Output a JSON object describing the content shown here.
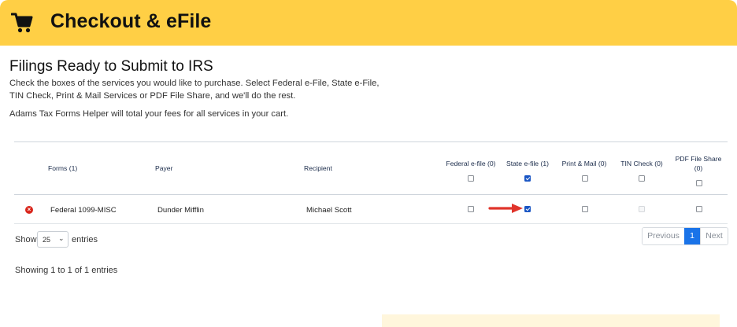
{
  "header": {
    "title": "Checkout & eFile",
    "icon": "shopping-cart-icon"
  },
  "page": {
    "title": "Filings Ready to Submit to IRS",
    "intro": "Check the boxes of the services you would like to purchase. Select Federal e-File, State e-File, TIN Check, Print & Mail Services or PDF File Share, and we'll do the rest.",
    "fees_note": "Adams Tax Forms Helper will total your fees for all services in your cart."
  },
  "table": {
    "columns": {
      "forms": "Forms (1)",
      "payer": "Payer",
      "recipient": "Recipient",
      "federal": "Federal e-file (0)",
      "state": "State e-file (1)",
      "print_mail": "Print & Mail (0)",
      "tin_check": "TIN Check (0)",
      "pdf_share_line1": "PDF File Share",
      "pdf_share_line2": "(0)"
    },
    "select_all": {
      "federal": false,
      "state": true,
      "print_mail": false,
      "tin_check": false,
      "pdf_share": false
    },
    "rows": [
      {
        "form": "Federal 1099-MISC",
        "payer": "Dunder Mifflin",
        "recipient": "Michael Scott",
        "federal": false,
        "state": true,
        "print_mail": false,
        "tin_check": "disabled",
        "pdf_share": false
      }
    ]
  },
  "length_menu": {
    "show_label": "Show",
    "value": "25",
    "entries_label": "entries"
  },
  "pagination": {
    "previous": "Previous",
    "current": "1",
    "next": "Next"
  },
  "info": "Showing 1 to 1 of 1 entries",
  "colors": {
    "header_bg": "#ffcf45",
    "primary": "#1a73e8",
    "remove": "#d9261c",
    "arrow": "#e0342b"
  }
}
